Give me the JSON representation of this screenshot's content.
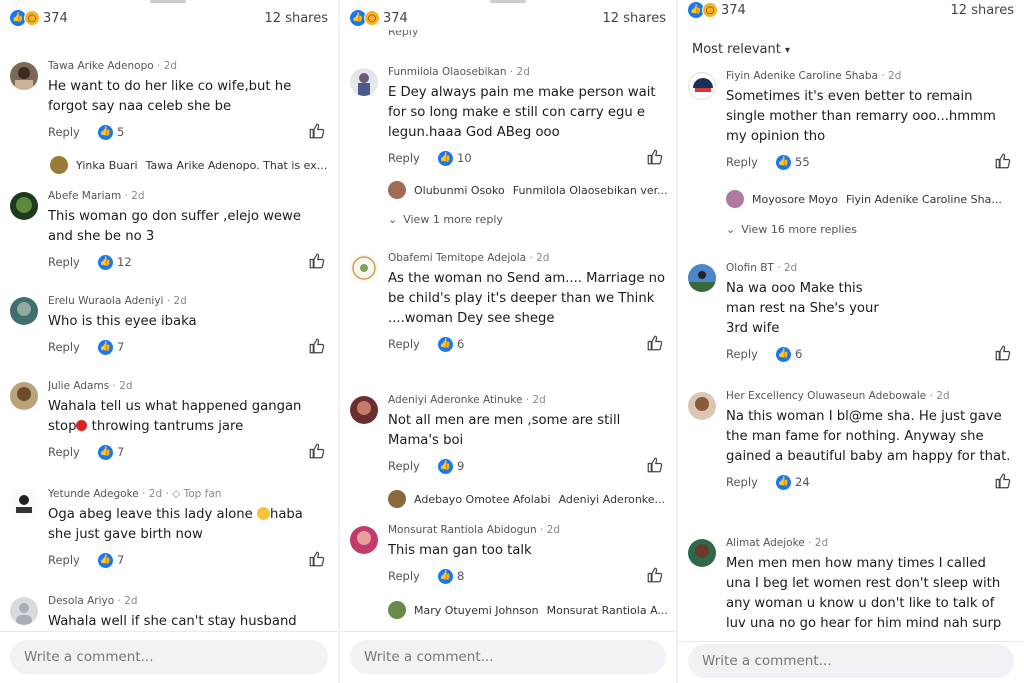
{
  "panels": [
    {
      "reactions_count": "374",
      "shares": "12 shares",
      "comments": [
        {
          "name": "Tawa Arike Adenopo",
          "time": "2d",
          "text": "He want to do her like co wife,but he forgot say naa celeb she be",
          "likes": "5",
          "sub": {
            "name": "Yinka Buari",
            "text": "Tawa Arike Adenopo. That is ex..."
          }
        },
        {
          "name": "Abefe Mariam",
          "time": "2d",
          "text": "This woman go don suffer ,elejo wewe and she be no 3",
          "likes": "12"
        },
        {
          "name": "Erelu Wuraola Adeniyi",
          "time": "2d",
          "text": "Who is this eyee ibaka",
          "likes": "7"
        },
        {
          "name": "Julie Adams",
          "time": "2d",
          "text_pre": "Wahala tell us what happened gangan stop",
          "text_post": " throwing tantrums jare",
          "likes": "7"
        },
        {
          "name": "Yetunde Adegoke",
          "time": "2d",
          "badge": "Top fan",
          "text_pre": "Oga abeg leave this lady alone ",
          "text_post": "haba she just gave birth now",
          "likes": "7"
        },
        {
          "name": "Desola Ariyo",
          "time": "2d",
          "text": "Wahala well if she can't stay husband"
        }
      ],
      "write_placeholder": "Write a comment..."
    },
    {
      "reactions_count": "374",
      "shares": "12 shares",
      "top_partial": "Reply",
      "comments": [
        {
          "name": "Funmilola Olaosebikan",
          "time": "2d",
          "text": "E Dey always pain me make person wait for so long make e still con carry  egu e legun.haaa God ABeg ooo",
          "likes": "10",
          "sub": {
            "name": "Olubunmi Osoko",
            "text": "Funmilola Olaosebikan ver..."
          },
          "more": "View 1 more reply"
        },
        {
          "name": "Obafemi Temitope Adejola",
          "time": "2d",
          "text": "As the woman no Send am.... Marriage no be child's play it's deeper than we Think ....woman Dey see shege",
          "likes": "6"
        },
        {
          "name": "Adeniyi Aderonke Atinuke",
          "time": "2d",
          "text": "Not all men are men ,some are still Mama's boi",
          "likes": "9",
          "sub": {
            "name": "Adebayo Omotee Afolabi",
            "text": "Adeniyi Aderonke..."
          }
        },
        {
          "name": "Monsurat Rantiola Abidogun",
          "time": "2d",
          "text": "This man gan too talk",
          "likes": "8",
          "sub": {
            "name": "Mary Otuyemi Johnson",
            "text": "Monsurat Rantiola A..."
          }
        }
      ],
      "write_placeholder": "Write a comment..."
    },
    {
      "reactions_count": "374",
      "shares": "12 shares",
      "sort_label": "Most relevant",
      "comments": [
        {
          "name": "Fiyin Adenike Caroline Shaba",
          "time": "2d",
          "text": "Sometimes it's even better to remain single mother than remarry ooo...hmmm my opinion tho",
          "likes": "55",
          "sub": {
            "name": "Moyosore Moyo",
            "text": "Fiyin Adenike Caroline Sha..."
          },
          "more": "View 16 more replies"
        },
        {
          "name": "Olofin BT",
          "time": "2d",
          "text": "Na wa ooo Make this man rest na She's your 3rd wife",
          "likes": "6"
        },
        {
          "name": "Her Excellency Oluwaseun Adebowale",
          "time": "2d",
          "text": "Na this woman I bl@me sha. He just gave the man fame for nothing. Anyway she gained a beautiful baby am happy for that.",
          "likes": "24"
        },
        {
          "name": "Alimat Adejoke",
          "time": "2d",
          "text": "Men men men how many times I called una I beg let women rest don't sleep with any woman u know u don't like to talk of luv una no go hear for him mind nah surp"
        }
      ],
      "write_placeholder": "Write a comment..."
    }
  ],
  "common": {
    "reply_label": "Reply"
  },
  "colors": {
    "like_blue": "#1877f2",
    "bg": "#ffffff",
    "input_bg": "#f0f2f5"
  }
}
